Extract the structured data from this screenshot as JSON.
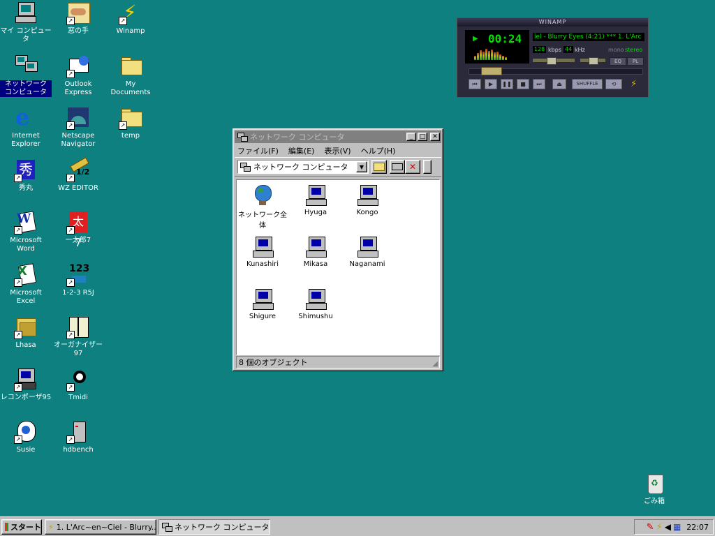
{
  "desktop": {
    "icons": [
      {
        "label": "マイ コンピュータ"
      },
      {
        "label": "ネットワーク\nコンピュータ"
      },
      {
        "label": "Internet\nExplorer"
      },
      {
        "label": "秀丸"
      },
      {
        "label": "Microsoft\nWord"
      },
      {
        "label": "Microsoft\nExcel"
      },
      {
        "label": "Lhasa"
      },
      {
        "label": "レコンポーザ95"
      },
      {
        "label": "Susie"
      },
      {
        "label": "窓の手"
      },
      {
        "label": "Outlook\nExpress"
      },
      {
        "label": "Netscape\nNavigator"
      },
      {
        "label": "WZ EDITOR"
      },
      {
        "label": "一太郎7"
      },
      {
        "label": "1-2-3 R5J"
      },
      {
        "label": "オーガナイザー\n97"
      },
      {
        "label": "Tmidi"
      },
      {
        "label": "hdbench"
      },
      {
        "label": "Winamp"
      },
      {
        "label": "My\nDocuments"
      },
      {
        "label": "temp"
      },
      {
        "label": "ごみ箱"
      }
    ]
  },
  "winamp": {
    "title": "WINAMP",
    "time": "00:24",
    "song": "iel - Blurry Eyes (4:21) *** 1. L'Arc",
    "kbps_value": "128",
    "kbps_label": "kbps",
    "khz_value": "44",
    "khz_label": "kHz",
    "mono_label": "mono",
    "stereo_label": "stereo",
    "eq_label": "EQ",
    "pl_label": "PL",
    "shuffle_label": "SHUFFLE"
  },
  "window": {
    "title": "ネットワーク コンピュータ",
    "menu": [
      "ファイル(F)",
      "編集(E)",
      "表示(V)",
      "ヘルプ(H)"
    ],
    "address": "ネットワーク コンピュータ",
    "items": [
      {
        "label": "ネットワーク全体",
        "icon": "globe-icon"
      },
      {
        "label": "Hyuga",
        "icon": "computer-icon"
      },
      {
        "label": "Kongo",
        "icon": "computer-icon"
      },
      {
        "label": "Kunashiri",
        "icon": "computer-icon"
      },
      {
        "label": "Mikasa",
        "icon": "computer-icon"
      },
      {
        "label": "Naganami",
        "icon": "computer-icon"
      },
      {
        "label": "Shigure",
        "icon": "computer-icon"
      },
      {
        "label": "Shimushu",
        "icon": "computer-icon"
      }
    ],
    "status": "8 個のオブジェクト"
  },
  "taskbar": {
    "start_label": "スタート",
    "tasks": [
      {
        "label": "1. L'Arc~en~Ciel - Blurry..."
      },
      {
        "label": "ネットワーク コンピュータ"
      }
    ],
    "clock": "22:07"
  }
}
